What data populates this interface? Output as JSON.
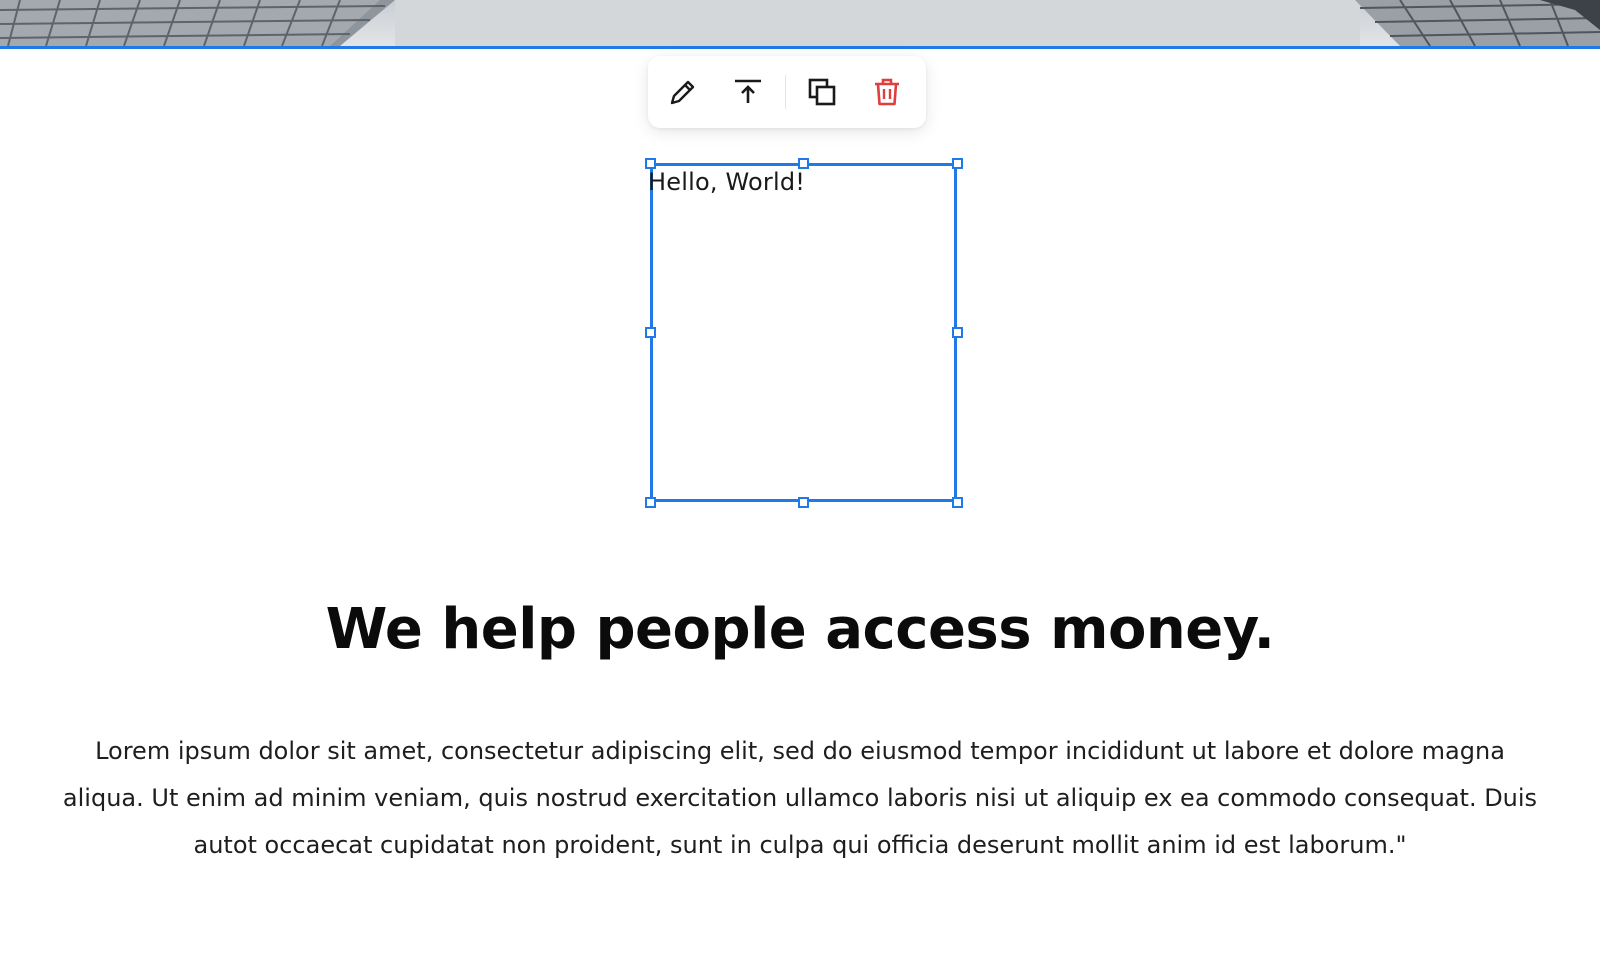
{
  "toolbar": {
    "buttons": [
      {
        "name": "edit",
        "icon": "pencil-icon"
      },
      {
        "name": "move-to-top",
        "icon": "arrow-up-to-line-icon"
      },
      {
        "name": "duplicate",
        "icon": "copy-icon"
      },
      {
        "name": "delete",
        "icon": "trash-icon",
        "color": "#e03e3e"
      }
    ]
  },
  "selected_element": {
    "text": "Hello, World!",
    "selection_color": "#1f7ae8"
  },
  "content": {
    "headline": "We help people access money.",
    "paragraph": "Lorem ipsum dolor sit amet, consectetur adipiscing elit, sed do eiusmod tempor incididunt ut labore et dolore magna aliqua. Ut enim ad minim veniam, quis nostrud exercitation ullamco laboris nisi ut aliquip ex ea commodo consequat. Duis autot occaecat cupidatat non proident, sunt in culpa qui officia deserunt mollit anim id est laborum.\""
  }
}
